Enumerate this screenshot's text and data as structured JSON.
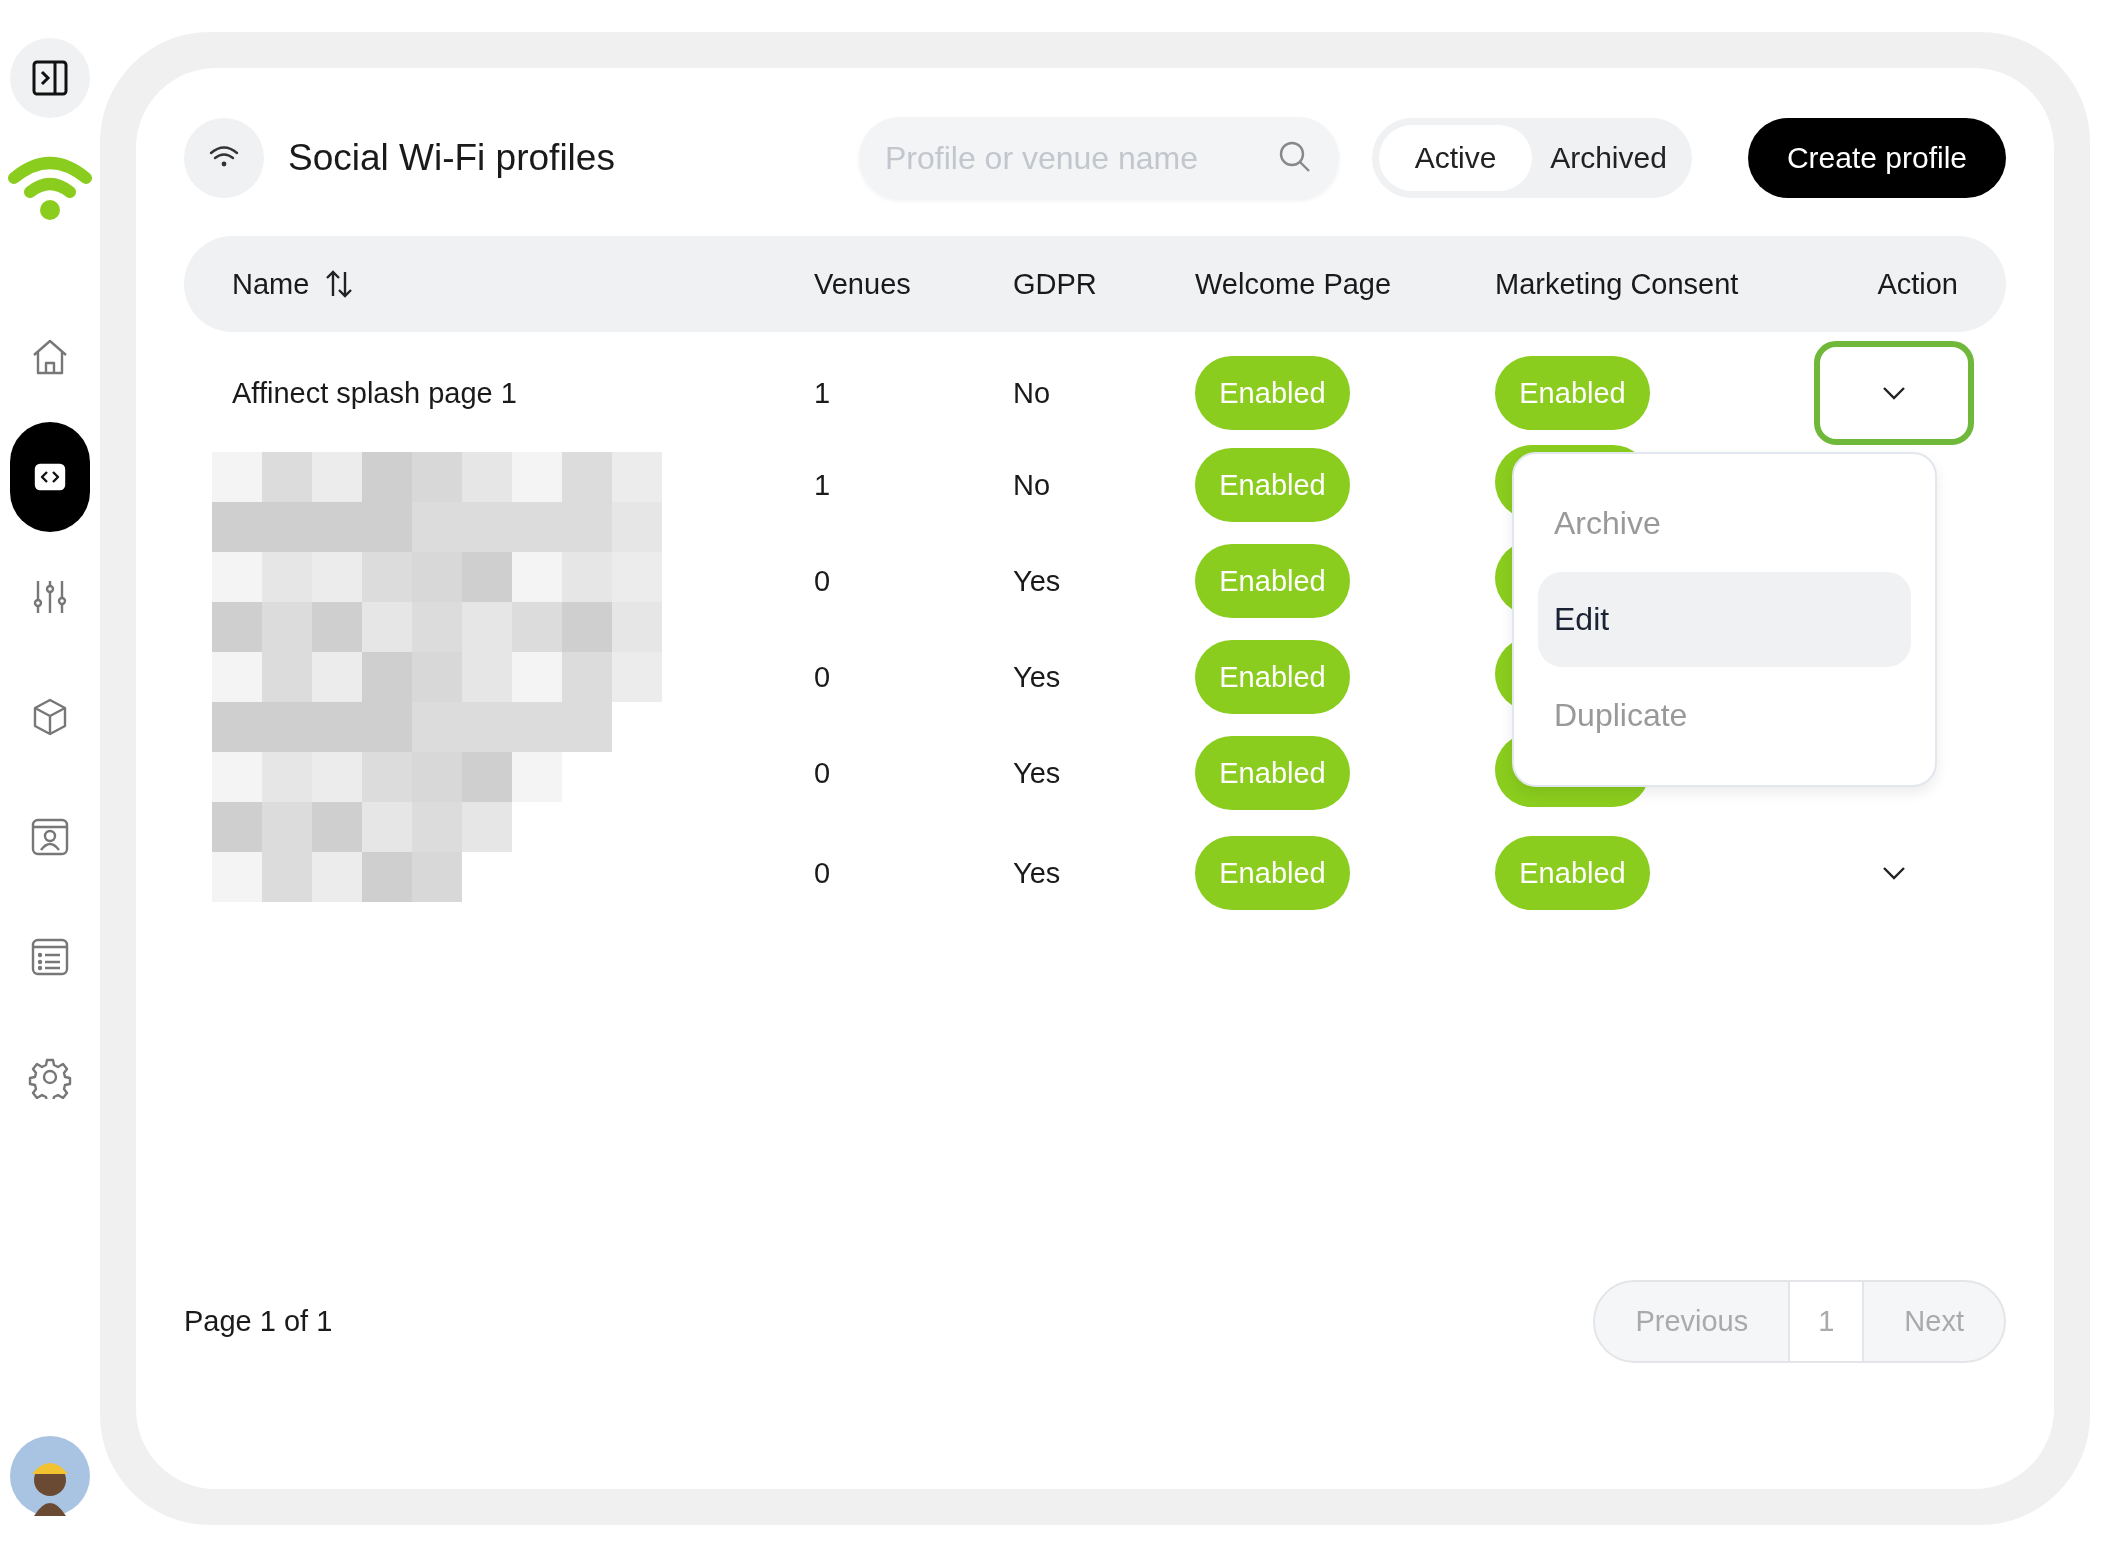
{
  "sidebar": {
    "items": [
      {
        "kind": "home",
        "selected": false
      },
      {
        "kind": "code",
        "selected": true
      },
      {
        "kind": "sliders",
        "selected": false
      },
      {
        "kind": "cube",
        "selected": false
      },
      {
        "kind": "contact",
        "selected": false
      },
      {
        "kind": "list",
        "selected": false
      },
      {
        "kind": "gear",
        "selected": false
      }
    ]
  },
  "header": {
    "title": "Social Wi-Fi profiles",
    "search": {
      "placeholder": "Profile or venue name"
    },
    "tabs": [
      {
        "label": "Active",
        "selected": true
      },
      {
        "label": "Archived",
        "selected": false
      }
    ],
    "create_button": "Create profile"
  },
  "table": {
    "columns": [
      "Name",
      "Venues",
      "GDPR",
      "Welcome Page",
      "Marketing Consent",
      "Action"
    ],
    "redacted_names": {
      "kind": "picture"
    },
    "rows": [
      {
        "name": "Affinect splash page 1",
        "venues": "1",
        "gdpr": "No",
        "welcome": "Enabled",
        "marketing": {
          "label": "Enabled"
        },
        "action": {
          "expanded": true
        }
      },
      {
        "venues": "1",
        "gdpr": "No",
        "welcome": "Enabled",
        "marketing": {}
      },
      {
        "venues": "0",
        "gdpr": "Yes",
        "welcome": "Enabled",
        "marketing": {}
      },
      {
        "venues": "0",
        "gdpr": "Yes",
        "welcome": "Enabled",
        "marketing": {}
      },
      {
        "venues": "0",
        "gdpr": "Yes",
        "welcome": "Enabled",
        "marketing": {}
      },
      {
        "venues": "0",
        "gdpr": "Yes",
        "welcome": "Enabled",
        "marketing": {
          "label": "Enabled"
        },
        "action": {
          "expanded": false
        }
      }
    ]
  },
  "menu": {
    "items": [
      {
        "label": "Archive",
        "selected": false
      },
      {
        "label": "Edit",
        "selected": true
      },
      {
        "label": "Duplicate",
        "selected": false
      }
    ]
  },
  "footer": {
    "page_info": "Page 1 of 1",
    "pager": [
      "Previous",
      "1",
      "Next"
    ]
  }
}
